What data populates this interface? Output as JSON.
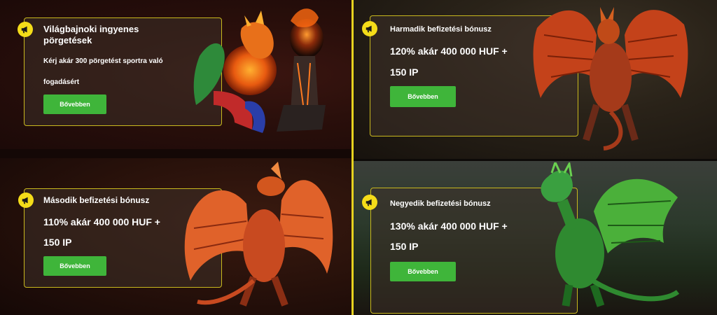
{
  "promos": [
    {
      "title": "Világbajnoki ingyenes pörgetések",
      "desc_line1": "Kérj akár 300 pörgetést sportra való",
      "desc_line2": "fogadásért",
      "button": "Bővebben",
      "art": "fire-dragon-with-football-icon"
    },
    {
      "title": "Harmadik befizetési bónusz",
      "offer_line1": "120% akár 400 000 HUF +",
      "offer_line2": "150 IP",
      "button": "Bővebben",
      "art": "red-winged-dragon-icon"
    },
    {
      "title": "Második befizetési bónusz",
      "offer_line1": "110% akár 400 000 HUF +",
      "offer_line2": "150 IP",
      "button": "Bővebben",
      "art": "orange-dragon-icon"
    },
    {
      "title": "Negyedik befizetési bónusz",
      "offer_line1": "130% akár 400 000 HUF +",
      "offer_line2": "150 IP",
      "button": "Bővebben",
      "art": "green-dragon-icon"
    }
  ],
  "colors": {
    "accent": "#f4dc19",
    "button": "#3fb53a",
    "divider": "#e6d21f"
  }
}
